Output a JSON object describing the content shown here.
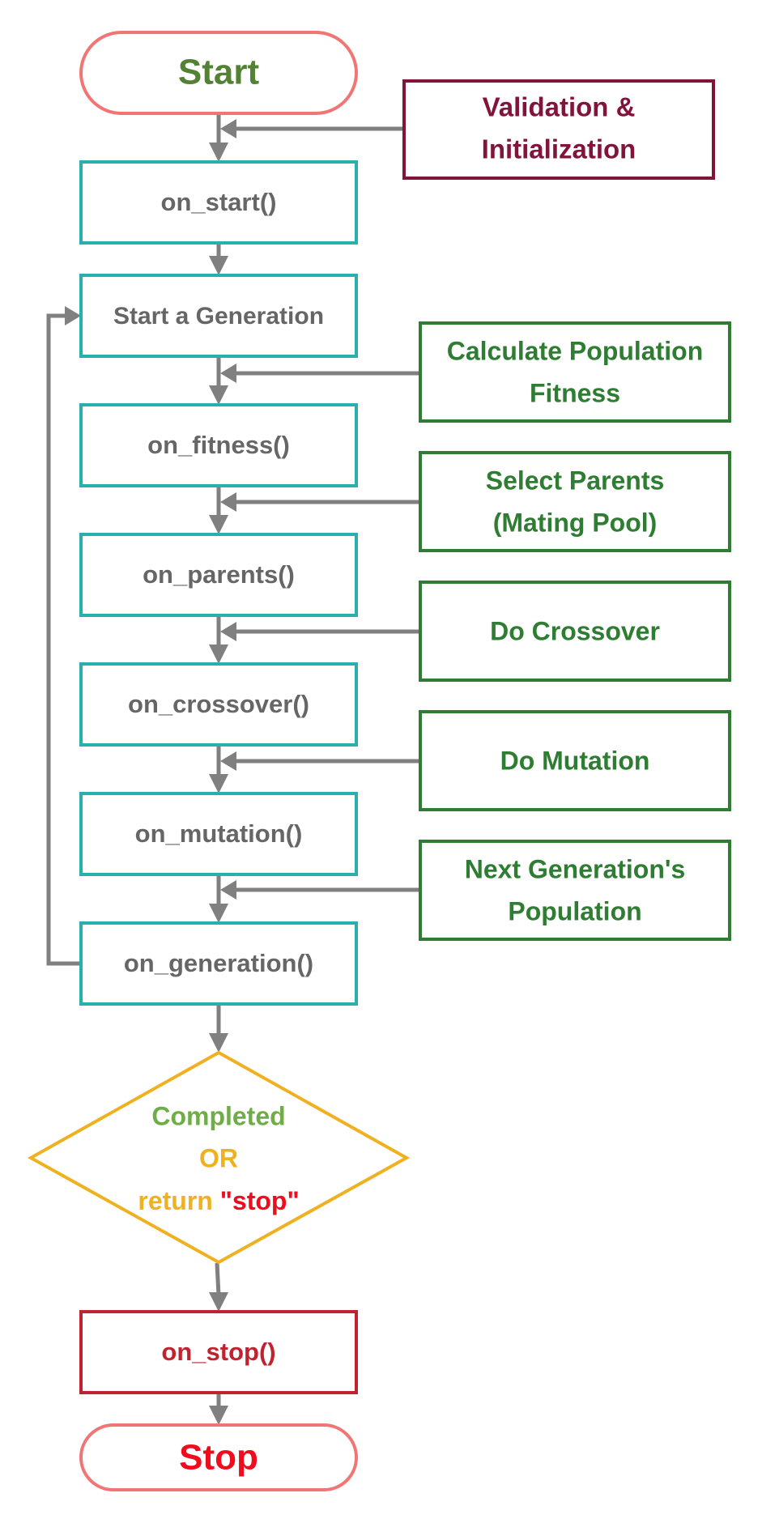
{
  "diagram": {
    "type": "flowchart",
    "colors": {
      "terminal_border": "#f07574",
      "start_text": "#548235",
      "stop_text": "#f00c1d",
      "callback_border": "#27b0ad",
      "callback_text": "#666666",
      "validation_border": "#82143c",
      "validation_text": "#82143c",
      "step_border": "#2e7d32",
      "step_text": "#2e7d32",
      "decision_border": "#f0b120",
      "completed_text": "#70ad47",
      "or_text": "#f0b120",
      "return_text": "#f0b120",
      "stop_string_text": "#f00c1d",
      "on_stop_border": "#c0232f",
      "on_stop_text": "#c0232f",
      "arrow": "#808080"
    },
    "start": {
      "label": "Start"
    },
    "validation": {
      "lines": [
        "Validation &",
        "Initialization"
      ]
    },
    "callbacks": [
      {
        "id": "on_start",
        "label": "on_start()"
      },
      {
        "id": "start_generation",
        "label": "Start a Generation"
      },
      {
        "id": "on_fitness",
        "label": "on_fitness()"
      },
      {
        "id": "on_parents",
        "label": "on_parents()"
      },
      {
        "id": "on_crossover",
        "label": "on_crossover()"
      },
      {
        "id": "on_mutation",
        "label": "on_mutation()"
      },
      {
        "id": "on_generation",
        "label": "on_generation()"
      }
    ],
    "steps": [
      {
        "lines": [
          "Calculate Population",
          "Fitness"
        ]
      },
      {
        "lines": [
          "Select Parents",
          "(Mating Pool)"
        ]
      },
      {
        "lines": [
          "Do Crossover"
        ]
      },
      {
        "lines": [
          "Do Mutation"
        ]
      },
      {
        "lines": [
          "Next Generation's",
          "Population"
        ]
      }
    ],
    "decision": {
      "line1": "Completed",
      "line2": "OR",
      "line3_a": "return",
      "line3_b": "\"stop\""
    },
    "on_stop": {
      "label": "on_stop()"
    },
    "stop": {
      "label": "Stop"
    }
  }
}
